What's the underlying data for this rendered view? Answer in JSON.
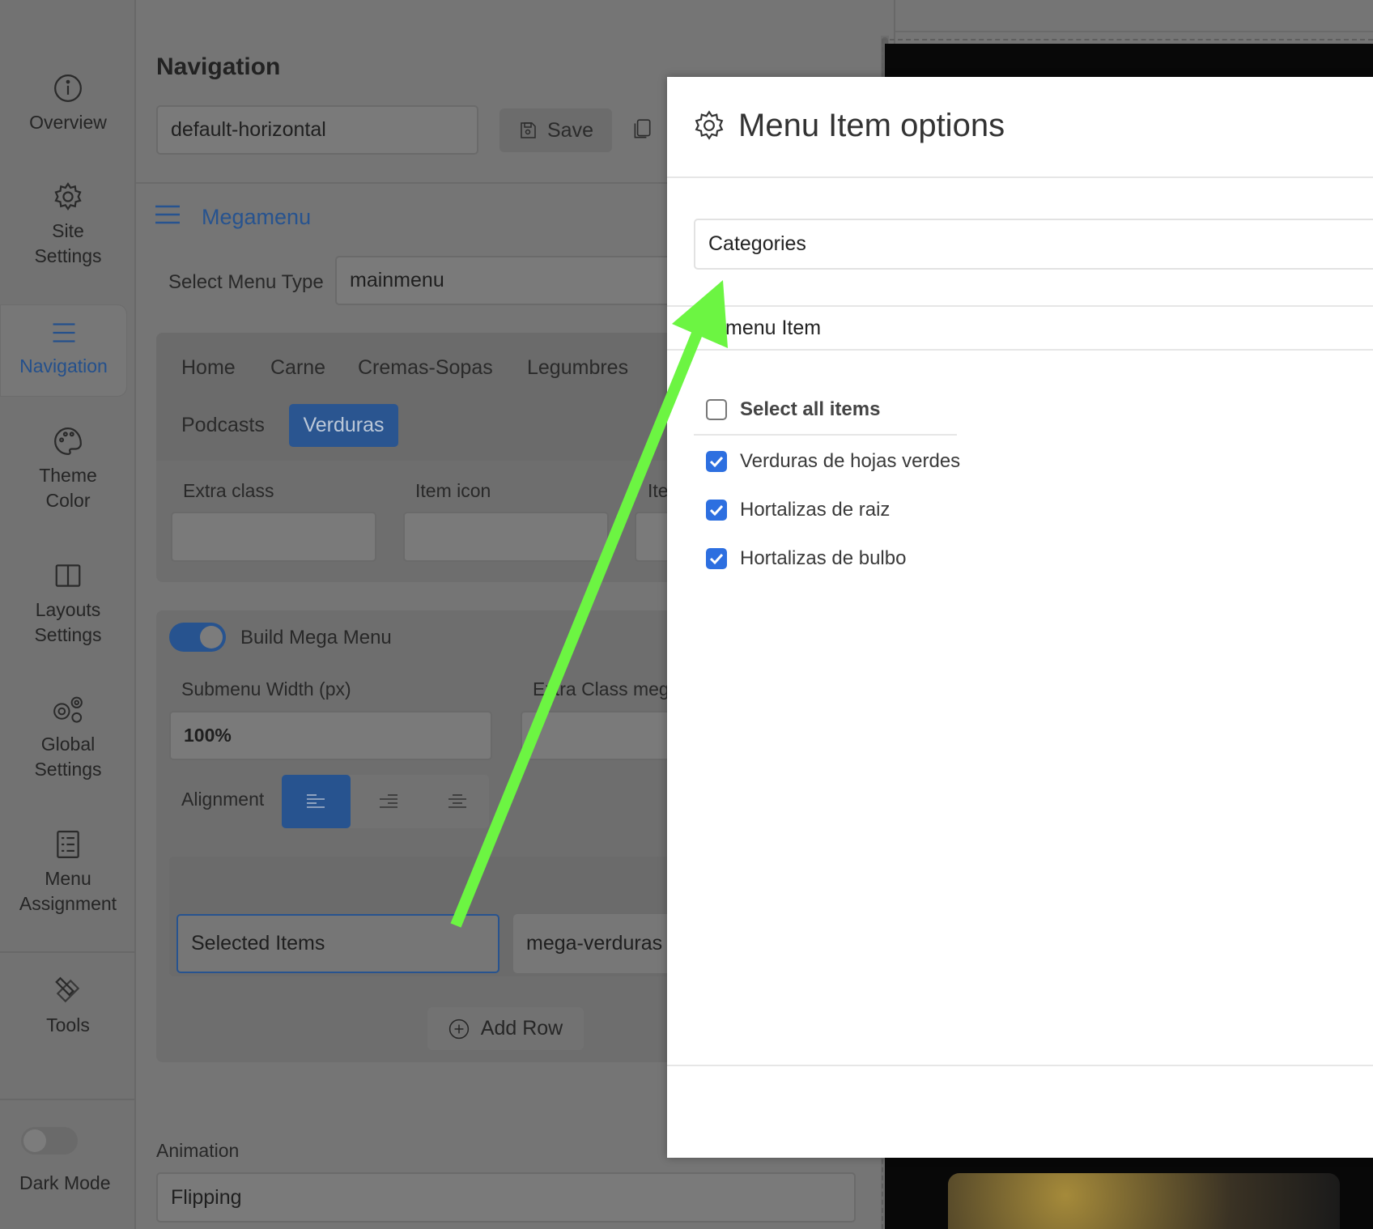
{
  "sidebar": {
    "items": [
      {
        "label": "Overview",
        "icon": "info-icon"
      },
      {
        "label": "Site Settings",
        "icon": "gear-icon"
      },
      {
        "label": "Navigation",
        "icon": "menu-icon",
        "active": true
      },
      {
        "label": "Theme Color",
        "icon": "palette-icon"
      },
      {
        "label": "Layouts Settings",
        "icon": "layout-icon"
      },
      {
        "label": "Global Settings",
        "icon": "gears-icon"
      },
      {
        "label": "Menu Assignment",
        "icon": "list-icon"
      },
      {
        "label": "Tools",
        "icon": "tools-icon"
      }
    ],
    "dark_mode_label": "Dark Mode",
    "dark_mode_on": false
  },
  "main": {
    "title": "Navigation",
    "preset_value": "default-horizontal",
    "save_label": "Save",
    "section_title": "Megamenu",
    "menu_type_label": "Select Menu Type",
    "menu_type_value": "mainmenu",
    "tabs": [
      "Home",
      "Carne",
      "Cremas-Sopas",
      "Legumbres",
      "Podcasts",
      "Verduras"
    ],
    "active_tab": "Verduras",
    "extra_class_label": "Extra class",
    "item_icon_label": "Item icon",
    "item_third_label": "Ite",
    "build_mega_label": "Build Mega Menu",
    "build_mega_on": true,
    "submenu_width_label": "Submenu Width (px)",
    "submenu_width_value": "100%",
    "extra_class_mega_label": "Extra Class meg",
    "alignment_label": "Alignment",
    "selected_items_label": "Selected Items",
    "row_class_value": "mega-verduras",
    "add_row_label": "Add Row",
    "animation_label": "Animation",
    "animation_value": "Flipping"
  },
  "modal": {
    "title": "Menu Item options",
    "source_value": "Categories",
    "subheading": "menu Item",
    "select_all_label": "Select all items",
    "items": [
      {
        "label": "Verduras de hojas verdes",
        "checked": true
      },
      {
        "label": "Hortalizas de raiz",
        "checked": true
      },
      {
        "label": "Hortalizas de bulbo",
        "checked": true
      }
    ]
  },
  "colors": {
    "accent": "#2d6fe0",
    "arrow": "#6cf542"
  }
}
